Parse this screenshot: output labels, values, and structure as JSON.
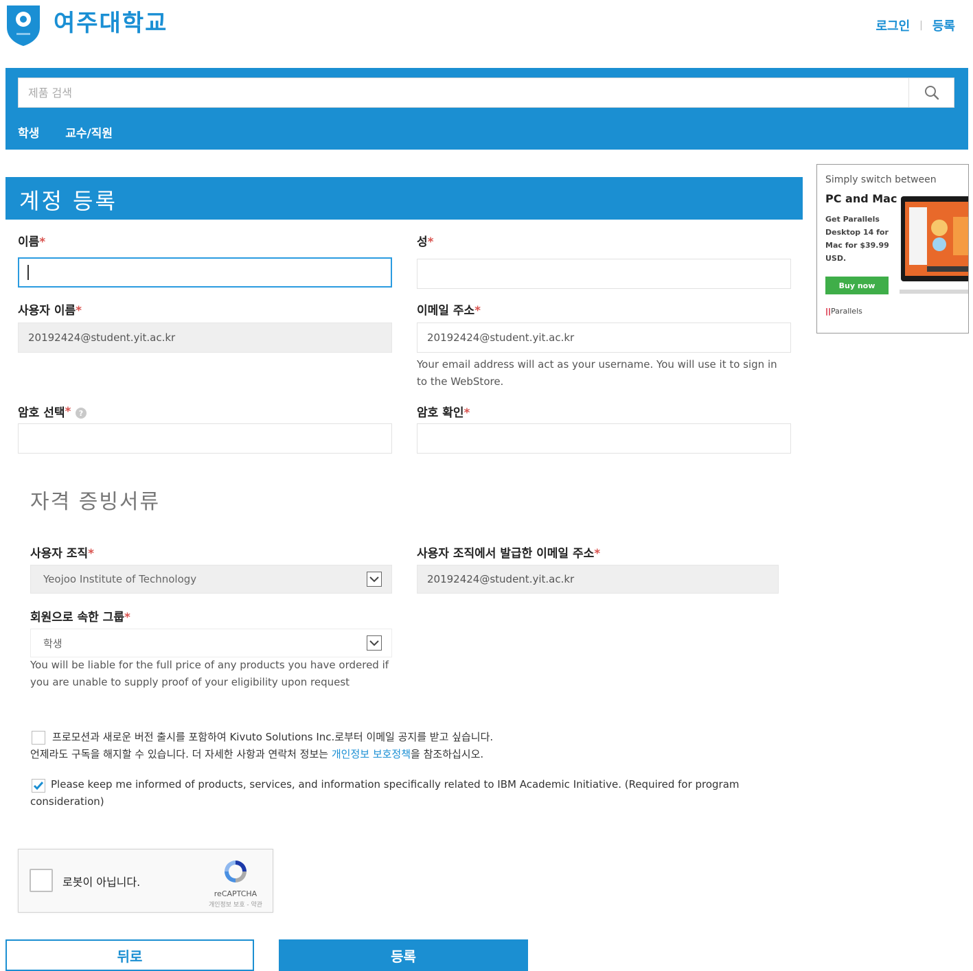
{
  "header": {
    "logo_text": "여주대학교",
    "login_label": "로그인",
    "separator": "|",
    "register_label": "등록"
  },
  "search": {
    "placeholder": "제품 검색"
  },
  "nav": {
    "items": [
      "학생",
      "교수/직원"
    ]
  },
  "page_title": "계정 등록",
  "form": {
    "first_name": {
      "label": "이름",
      "value": ""
    },
    "last_name": {
      "label": "성",
      "value": ""
    },
    "username": {
      "label": "사용자 이름",
      "value": "20192424@student.yit.ac.kr"
    },
    "email": {
      "label": "이메일 주소",
      "value": "20192424@student.yit.ac.kr",
      "help": "Your email address will act as your username. You will use it to sign in to the WebStore."
    },
    "password": {
      "label": "암호 선택",
      "value": ""
    },
    "password_confirm": {
      "label": "암호 확인",
      "value": ""
    },
    "required_mark": "*"
  },
  "credentials": {
    "section_title": "자격 증빙서류",
    "organization": {
      "label": "사용자 조직",
      "value": "Yeojoo Institute of Technology"
    },
    "org_email": {
      "label": "사용자 조직에서 발급한 이메일 주소",
      "value": "20192424@student.yit.ac.kr"
    },
    "group": {
      "label": "회원으로 속한 그룹",
      "value": "학생",
      "help": "You will be liable for the full price of any products you have ordered if you are unable to supply proof of your eligibility upon request"
    }
  },
  "consents": {
    "promo": {
      "checked": false,
      "text_line1": "프로모션과 새로운 버전 출시를 포함하여 Kivuto Solutions Inc.로부터 이메일 공지를 받고 싶습니다.",
      "text_line2_before": "언제라도 구독을 해지할 수 있습니다. 더 자세한 사항과 연락처 정보는 ",
      "link": "개인정보 보호정책",
      "text_line2_after": "을 참조하십시오."
    },
    "ibm": {
      "checked": true,
      "text": "Please keep me informed of products, services, and information specifically related to IBM Academic Initiative. (Required for program consideration)"
    }
  },
  "recaptcha": {
    "label": "로봇이 아닙니다.",
    "brand": "reCAPTCHA",
    "sub": "개인정보 보호 - 약관"
  },
  "buttons": {
    "back": "뒤로",
    "submit": "등록"
  },
  "ad": {
    "line1": "Simply switch between",
    "line2": "PC and Mac",
    "line3": "Get Parallels Desktop 14 for Mac for $39.99 USD.",
    "buy": "Buy now",
    "brand_mark": "||",
    "brand": "Parallels"
  },
  "colors": {
    "primary": "#1b8fd2",
    "required": "#d9534f",
    "buy_green": "#3fae49"
  }
}
